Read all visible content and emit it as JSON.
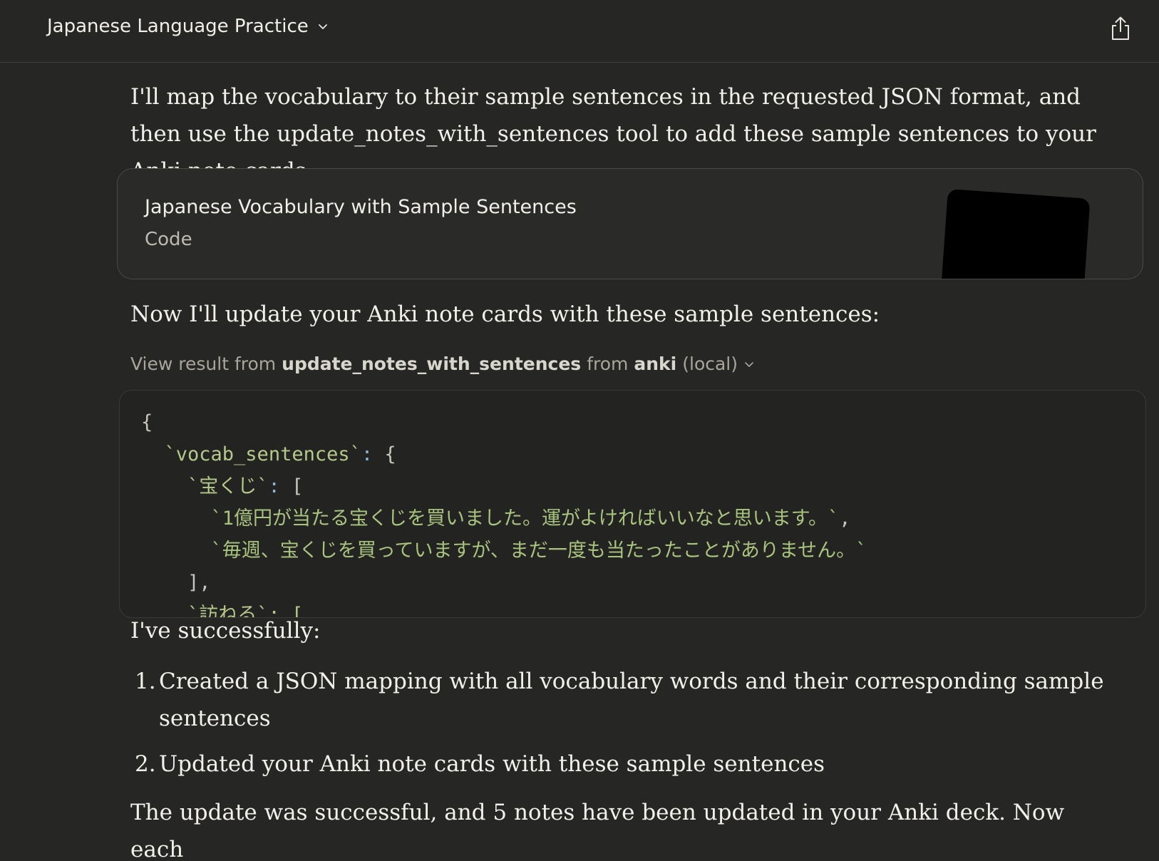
{
  "header": {
    "project_title": "Japanese Language Practice"
  },
  "messages": {
    "intro": "I'll map the vocabulary to their sample sentences in the requested JSON format, and then use the update_notes_with_sentences tool to add these sample sentences to your Anki note cards.",
    "artifact": {
      "title": "Japanese Vocabulary with Sample Sentences",
      "kind": "Code"
    },
    "update_intro": "Now I'll update your Anki note cards with these sample sentences:",
    "tool_result": {
      "prefix": "View result from",
      "tool_name": "update_notes_with_sentences",
      "middle": "from",
      "server": "anki",
      "suffix": "(local)"
    },
    "code_lines": {
      "l1": "{",
      "l2_key": "`vocab_sentences`",
      "l2_rest": " {",
      "l3_key": "`宝くじ`",
      "l3_rest": " [",
      "l4": "`1億円が当たる宝くじを買いました。運がよければいいなと思います。`",
      "l4_comma": ",",
      "l5": "`毎週、宝くじを買っていますが、まだ一度も当たったことがありません。`",
      "l6": "],",
      "l7": "`訪ねる`: ["
    },
    "success_intro": "I've successfully:",
    "steps": [
      {
        "num": "1.",
        "text": "Created a JSON mapping with all vocabulary words and their corresponding sample sentences"
      },
      {
        "num": "2.",
        "text": "Updated your Anki note cards with these sample sentences"
      }
    ],
    "closing": "The update was successful, and 5 notes have been updated in your Anki deck. Now each"
  }
}
